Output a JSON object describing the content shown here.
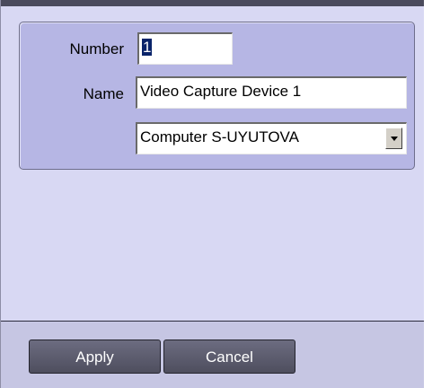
{
  "form": {
    "number_label": "Number",
    "number_value": "1",
    "name_label": "Name",
    "name_value": "Video Capture Device 1",
    "computer_value": "Computer S-UYUTOVA"
  },
  "buttons": {
    "apply_label": "Apply",
    "cancel_label": "Cancel"
  },
  "colors": {
    "panel_bg": "#d8d8f3",
    "group_bg": "#b6b6e4",
    "button_bg": "#5a5a6c",
    "selection": "#0a246a"
  },
  "icons": {
    "combo_arrow": "chevron-down-icon"
  }
}
